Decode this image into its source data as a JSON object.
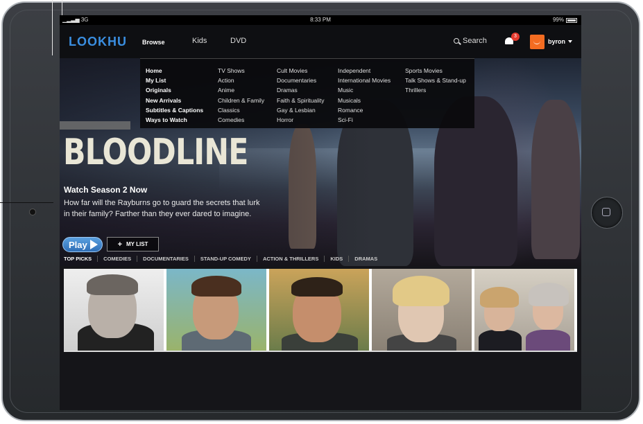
{
  "status_bar": {
    "carrier": "3G",
    "time": "8:33 PM",
    "battery": "99%"
  },
  "nav": {
    "logo": "LOOKHU",
    "browse": "Browse",
    "kids": "Kids",
    "dvd": "DVD",
    "search": "Search",
    "notifications_count": "3",
    "username": "byron"
  },
  "browse_menu": {
    "col1": [
      "Home",
      "My List",
      "Originals",
      "New Arrivals",
      "Subtitles & Captions",
      "Ways to Watch"
    ],
    "col2": [
      "TV Shows",
      "Action",
      "Anime",
      "Children & Family",
      "Classics",
      "Comedies"
    ],
    "col3": [
      "Cult Movies",
      "Documentaries",
      "Dramas",
      "Faith & Spirituality",
      "Gay & Lesbian",
      "Horror"
    ],
    "col4": [
      "Independent",
      "International Movies",
      "Music",
      "Musicals",
      "Romance",
      "Sci-Fi"
    ],
    "col5": [
      "Sports Movies",
      "Talk Shows & Stand-up",
      "Thrillers"
    ]
  },
  "hero": {
    "title_art": "BLOODLINE",
    "subtitle": "Watch Season 2 Now",
    "description": "How far will the Rayburns go to guard the secrets that lurk in their family? Farther than they ever dared to imagine.",
    "play_label": "Play",
    "mylist_label": "MY LIST",
    "mylist_prefix": "+"
  },
  "categories": [
    "TOP PICKS",
    "COMEDIES",
    "DOCUMENTARIES",
    "STAND-UP COMEDY",
    "ACTION & THRILLERS",
    "KIDS",
    "DRAMAS"
  ],
  "colors": {
    "accent": "#3a8ee0",
    "badge": "#e53a2e",
    "avatar": "#f36c21"
  }
}
